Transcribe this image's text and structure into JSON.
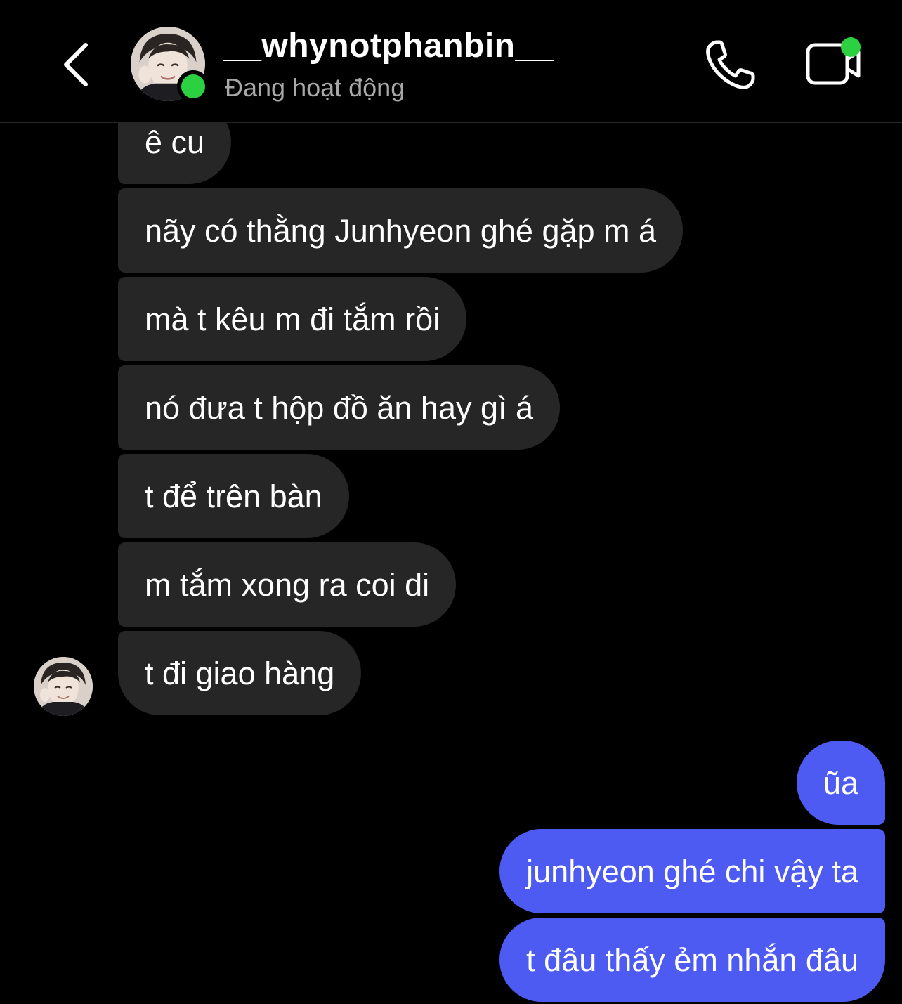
{
  "header": {
    "username": "__whynotphanbin__",
    "status": "Đang hoạt động",
    "back_icon": "chevron-left-icon",
    "call_icon": "phone-icon",
    "video_icon": "video-camera-icon",
    "online_color": "#2bd140"
  },
  "messages": {
    "incoming": [
      "ê cu",
      "nãy có thằng Junhyeon ghé gặp m á",
      "mà t kêu m đi tắm rồi",
      "nó đưa t hộp đồ ăn hay gì á",
      "t để trên bàn",
      "m tắm xong ra coi di",
      "t đi giao hàng"
    ],
    "outgoing": [
      "ũa",
      "junhyeon ghé chi vậy ta",
      "t đâu thấy ẻm nhắn đâu"
    ]
  },
  "colors": {
    "background": "#000000",
    "incoming_bubble": "#262626",
    "outgoing_bubble": "#4d5bf2",
    "status_text": "#a8a8a8"
  }
}
